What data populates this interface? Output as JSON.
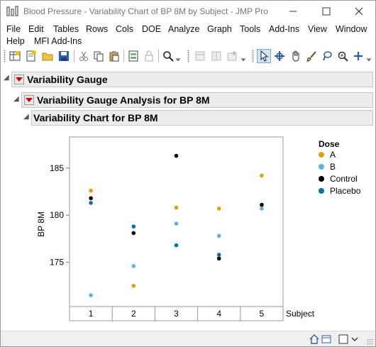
{
  "window": {
    "title": "Blood Pressure - Variability Chart of BP 8M by Subject - JMP Pro"
  },
  "menu": [
    "File",
    "Edit",
    "Tables",
    "Rows",
    "Cols",
    "DOE",
    "Analyze",
    "Graph",
    "Tools",
    "Add-Ins",
    "View",
    "Window",
    "Help",
    "MFI Add-Ins"
  ],
  "report": {
    "outline1": "Variability Gauge",
    "outline2": "Variability Gauge Analysis for BP 8M",
    "outline3": "Variability Chart for BP 8M"
  },
  "legend": {
    "title": "Dose",
    "items": [
      {
        "label": "A",
        "color": "#E69F00"
      },
      {
        "label": "B",
        "color": "#56B4E9"
      },
      {
        "label": "Control",
        "color": "#000000"
      },
      {
        "label": "Placebo",
        "color": "#0072B2"
      }
    ]
  },
  "chart_data": {
    "type": "scatter",
    "ylabel": "BP 8M",
    "xlabel": "Subject",
    "categories": [
      "1",
      "2",
      "3",
      "4",
      "5"
    ],
    "yticks": [
      175,
      180,
      185
    ],
    "ylim": [
      170.3,
      188.3
    ],
    "series": [
      {
        "name": "A",
        "color": "#E69F00",
        "values": [
          182.6,
          172.5,
          180.8,
          180.7,
          184.2
        ]
      },
      {
        "name": "B",
        "color": "#56B4E9",
        "values": [
          171.5,
          174.6,
          179.1,
          177.8,
          180.7
        ]
      },
      {
        "name": "Control",
        "color": "#000000",
        "values": [
          181.8,
          178.1,
          186.3,
          175.4,
          181.1
        ]
      },
      {
        "name": "Placebo",
        "color": "#0072B2",
        "values": [
          181.3,
          178.8,
          176.8,
          175.8,
          null
        ]
      }
    ]
  }
}
